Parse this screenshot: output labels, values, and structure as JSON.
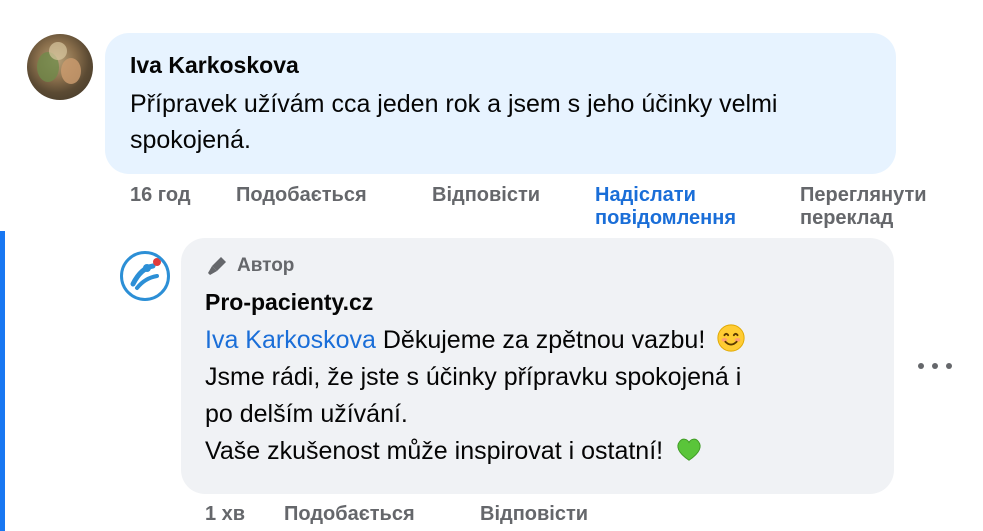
{
  "comment": {
    "author": "Iva Karkoskova",
    "text": "Přípravek užívám cca jeden rok a jsem s jeho účinky velmi spokojená.",
    "time": "16 год",
    "actions": {
      "like": "Подобається",
      "reply": "Відповісти",
      "send_message_line1": "Надіслати",
      "send_message_line2": "повідомлення",
      "see_translation_line1": "Переглянути",
      "see_translation_line2": "переклад"
    }
  },
  "reply": {
    "badge": "Автор",
    "author": "Pro-pacienty.cz",
    "mention": "Iva Karkoskova",
    "line1_rest": " Děkujeme za zpětnou vazbu!",
    "line2": "Jsme rádi, že jste s účinky přípravku spokojená i",
    "line3": "po delším užívání.",
    "line4": "Vaše zkušenost může inspirovat i ostatní!",
    "emoji1": "smiling-face-emoji",
    "emoji2": "green-heart-emoji",
    "time": "1 хв",
    "actions": {
      "like": "Подобається",
      "reply": "Відповісти"
    }
  },
  "colors": {
    "comment_bubble": "#e7f3ff",
    "reply_bubble": "#f0f2f5",
    "link_blue": "#1a6ed8",
    "muted": "#65676b",
    "thread_line": "#1877f2"
  }
}
